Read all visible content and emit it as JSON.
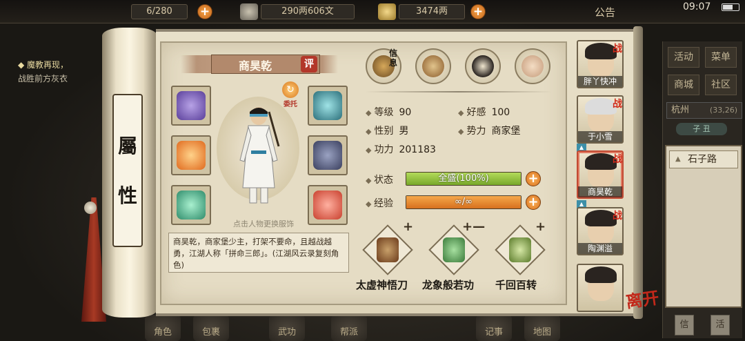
{
  "top_bar": {
    "bag_count": "6/280",
    "copper": "290两606文",
    "silver": "3474两",
    "notice": "公告",
    "time": "09:07"
  },
  "quest": {
    "title": "魔教再现，",
    "desc": "战胜前方灰衣"
  },
  "scroll": {
    "label_top": "屬",
    "label_bottom": "性"
  },
  "character": {
    "name": "商昊乾",
    "eval_badge": "评",
    "delegate": "委托",
    "hint": "点击人物更换服饰",
    "bio": "商昊乾，商家堡少主，打架不要命，且越战越勇，江湖人称「拼命三郎」。(江湖风云录复刻角色)"
  },
  "categories": [
    {
      "name": "info-icon",
      "label": "信息",
      "active": true
    },
    {
      "name": "scroll-map-icon"
    },
    {
      "name": "bagua-icon"
    },
    {
      "name": "body-meridian-icon"
    }
  ],
  "stats": {
    "level_label": "等级",
    "level": "90",
    "affinity_label": "好感",
    "affinity": "100",
    "gender_label": "性别",
    "gender": "男",
    "faction_label": "势力",
    "faction": "商家堡",
    "power_label": "功力",
    "power": "201183"
  },
  "bars": {
    "state_label": "状态",
    "state_text": "全盛(100%)",
    "state_fill": 100,
    "exp_label": "经验",
    "exp_text": "∞/∞",
    "exp_fill": 100
  },
  "skills": [
    {
      "name": "太虚神悟刀",
      "plus": "+"
    },
    {
      "name": "龙象般若功",
      "plus": "+—"
    },
    {
      "name": "千回百转",
      "plus": "+"
    }
  ],
  "party": [
    {
      "name": "胖丫快冲",
      "battle": "战"
    },
    {
      "name": "于小雪",
      "battle": "战"
    },
    {
      "name": "商昊乾",
      "battle": "战",
      "selected": true
    },
    {
      "name": "陶渊溢",
      "battle": "战"
    },
    {
      "name": ""
    }
  ],
  "leave": "离开",
  "right_menu": {
    "activity": "活动",
    "menu": "菜单",
    "mall": "商城",
    "community": "社区",
    "city": "杭州",
    "coord": "(33,26)",
    "time_of_day": "子 丑",
    "road": "石子路"
  },
  "bottom_nav": [
    "角色",
    "包裹",
    "武功",
    "帮派",
    "记事",
    "地图"
  ],
  "colors": {
    "state_bar": "#8fbe3a",
    "exp_bar": "#e58a2c",
    "accent_red": "#b3372a"
  }
}
